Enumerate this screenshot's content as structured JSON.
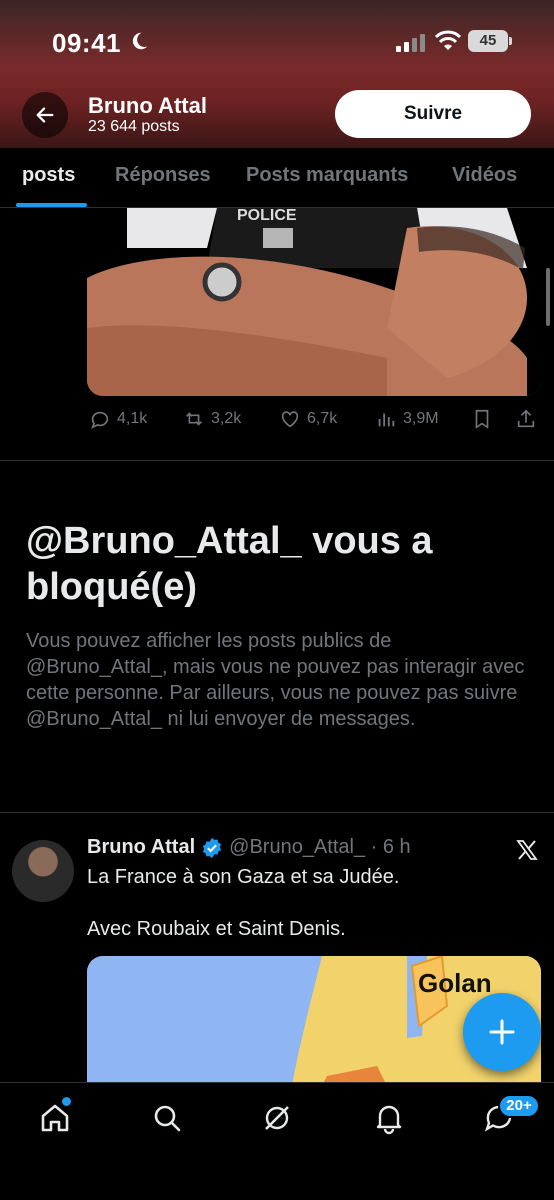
{
  "status_bar": {
    "time": "09:41",
    "battery": "45"
  },
  "header": {
    "name": "Bruno Attal",
    "post_count": "23 644 posts",
    "follow_label": "Suivre"
  },
  "tabs": [
    {
      "label": "posts",
      "active": true
    },
    {
      "label": "Réponses",
      "active": false
    },
    {
      "label": "Posts marquants",
      "active": false
    },
    {
      "label": "Vidéos",
      "active": false
    }
  ],
  "post_image": {
    "text": "POLICE"
  },
  "actions": {
    "replies": "4,1k",
    "reposts": "3,2k",
    "likes": "6,7k",
    "views": "3,9M"
  },
  "blocked": {
    "title": "@Bruno_Attal_ vous a bloqué(e)",
    "description": "Vous pouvez afficher les posts publics de @Bruno_Attal_, mais vous ne pouvez pas interagir avec cette personne. Par ailleurs, vous ne pouvez pas suivre @Bruno_Attal_ ni lui envoyer de messages."
  },
  "tweet": {
    "author": "Bruno Attal",
    "handle": "@Bruno_Attal_ · 6 h",
    "line1": "La France à son Gaza et sa Judée.",
    "line2": "Avec Roubaix et Saint Denis.",
    "map_label": "Golan"
  },
  "bottom_nav": {
    "messages_badge": "20+"
  },
  "colors": {
    "accent": "#1d9bf0",
    "muted": "#71767b",
    "text": "#e7e9ea",
    "background": "#000000"
  }
}
